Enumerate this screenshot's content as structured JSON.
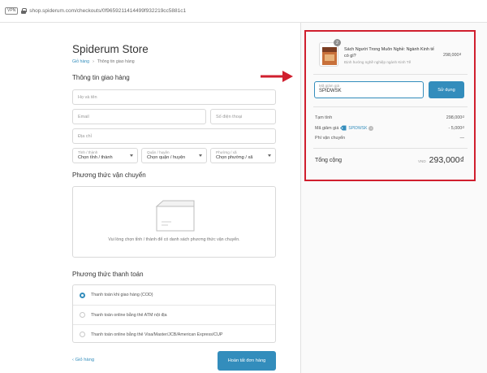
{
  "browser": {
    "vpn_label": "VPN",
    "url": "shop.spiderum.com/checkouts/0f9659211414499f932219cc5881c1"
  },
  "store": {
    "title": "Spiderum Store"
  },
  "breadcrumb": {
    "cart": "Giỏ hàng",
    "separator": "›",
    "current": "Thông tin giao hàng"
  },
  "shipping_info": {
    "title": "Thông tin giao hàng",
    "name_placeholder": "Họ và tên",
    "email_placeholder": "Email",
    "phone_placeholder": "Số điện thoại",
    "address_placeholder": "Địa chỉ",
    "province": {
      "label": "Tỉnh / thành",
      "value": "Chọn tỉnh / thành"
    },
    "district": {
      "label": "Quận / huyện",
      "value": "Chọn quận / huyện"
    },
    "ward": {
      "label": "Phường / xã",
      "value": "Chọn phường / xã"
    }
  },
  "shipping_method": {
    "title": "Phương thức vận chuyển",
    "message": "Vui lòng chọn tỉnh / thành để có danh sách phương thức vận chuyển."
  },
  "payment": {
    "title": "Phương thức thanh toán",
    "options": [
      {
        "label": "Thanh toán khi giao hàng (COD)",
        "selected": true
      },
      {
        "label": "Thanh toán online bằng thẻ ATM nội địa",
        "selected": false
      },
      {
        "label": "Thanh toán online bằng thẻ Visa/Master/JCB/American Express/CUP",
        "selected": false
      }
    ]
  },
  "actions": {
    "back_label": "Giỏ hàng",
    "back_icon": "chevron-left-icon",
    "finish_label": "Hoàn tất đơn hàng"
  },
  "order": {
    "product": {
      "quantity": "2",
      "name": "Sách Người Trong Muôn Nghề: Ngành Kinh tế có gì?",
      "subtitle": "Định hướng nghề nghiệp ngành Kinh Tế",
      "price": "298,000₫"
    },
    "coupon": {
      "label": "Mã giảm giá",
      "value": "SPIDWSK",
      "apply_label": "Sử dụng"
    },
    "subtotal_label": "Tạm tính",
    "subtotal_value": "298,000₫",
    "discount_label": "Mã giảm giá",
    "discount_code": "SPIDWSK",
    "discount_value": "- 5,000₫",
    "shipping_label": "Phí vận chuyển",
    "shipping_value": "—",
    "total_label": "Tổng cộng",
    "currency": "VND",
    "total_value": "293,000₫"
  },
  "colors": {
    "accent": "#338dbc",
    "highlight_red": "#d01f2e"
  }
}
